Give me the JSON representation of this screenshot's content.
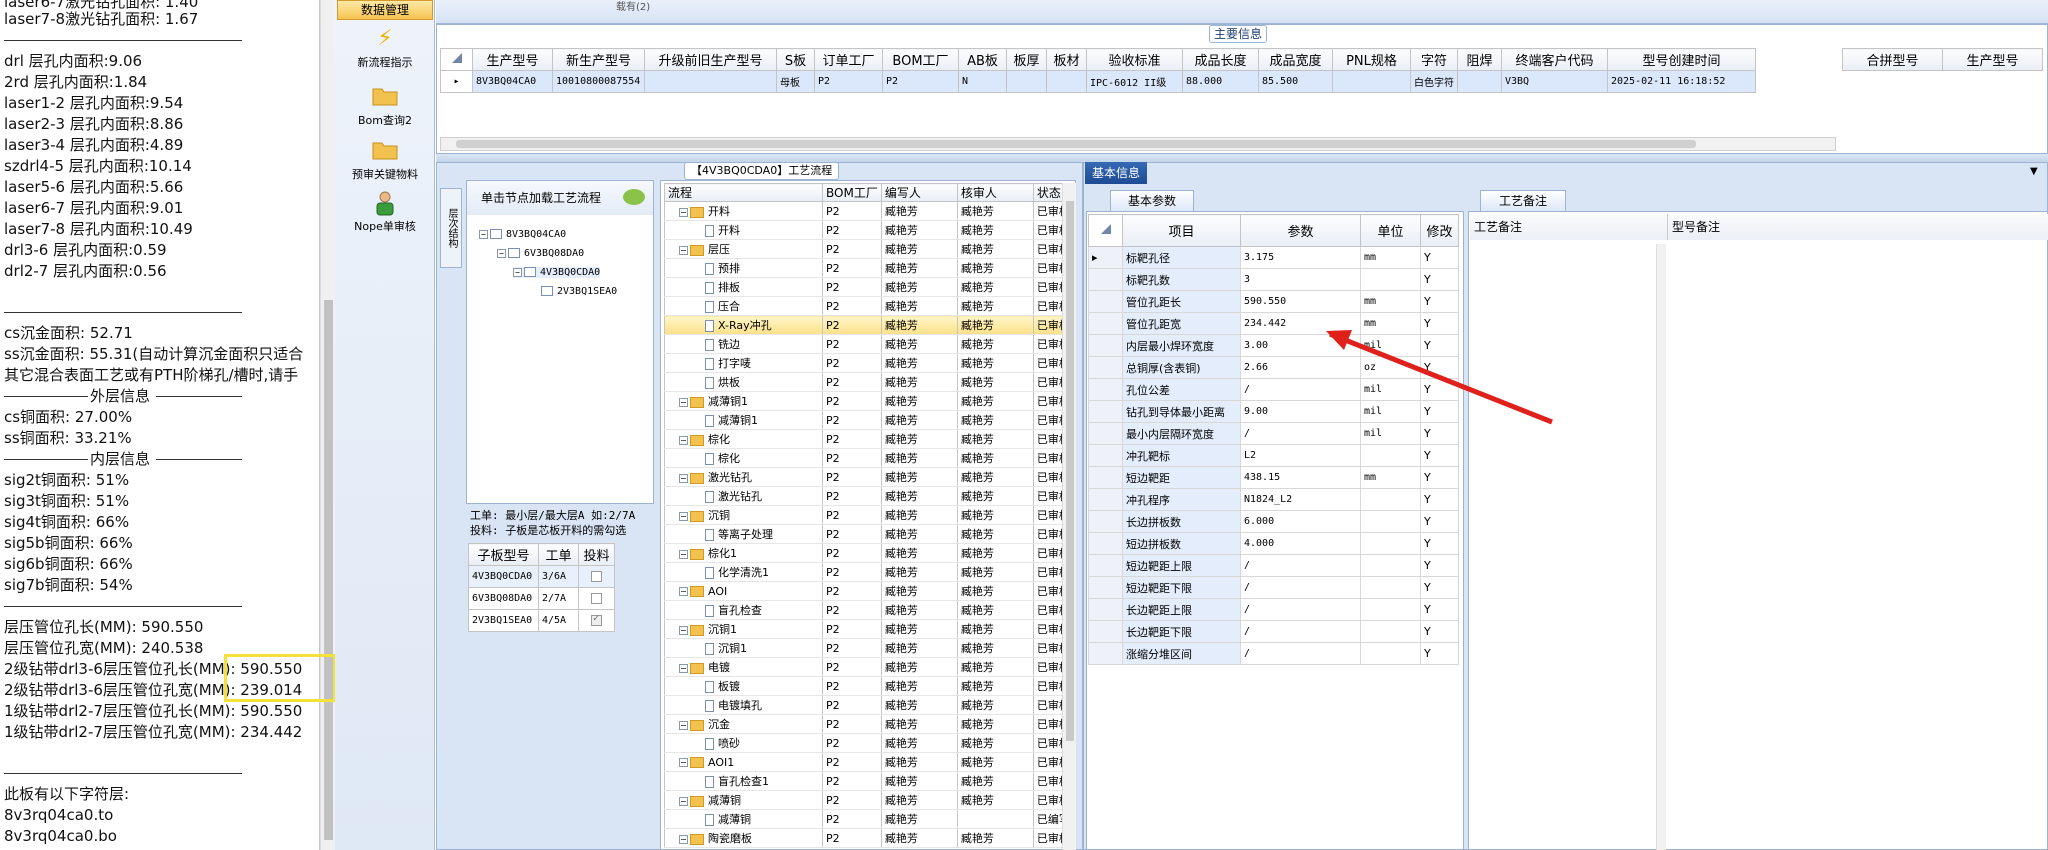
{
  "left_panel": {
    "lines": [
      "laser6-7激光钻孔面积: 1.40",
      "laser7-8激光钻孔面积: 1.67",
      "drl           层孔内面积:9.06",
      "2rd          层孔内面积:1.84",
      "laser1-2     层孔内面积:9.54",
      "laser2-3     层孔内面积:8.86",
      "laser3-4     层孔内面积:4.89",
      "szdrl4-5     层孔内面积:10.14",
      "laser5-6     层孔内面积:5.66",
      "laser6-7     层孔内面积:9.01",
      "laser7-8     层孔内面积:10.49",
      "drl3-6       层孔内面积:0.59",
      "drl2-7       层孔内面积:0.56",
      "cs沉金面积: 52.71",
      "ss沉金面积: 55.31(自动计算沉金面积只适合",
      "其它混合表面工艺或有PTH阶梯孔/槽时,请手",
      "外层信息",
      "cs铜面积: 27.00%",
      "ss铜面积: 33.21%",
      "内层信息",
      "sig2t铜面积: 51%",
      "sig3t铜面积: 51%",
      "sig4t铜面积: 66%",
      "sig5b铜面积: 66%",
      "sig6b铜面积: 66%",
      "sig7b铜面积: 54%",
      "层压管位孔长(MM): 590.550",
      "层压管位孔宽(MM): 240.538",
      "2级钻带drl3-6层压管位孔长(MM): 590.550",
      "2级钻带drl3-6层压管位孔宽(MM): 239.014",
      "1级钻带drl2-7层压管位孔长(MM): 590.550",
      "1级钻带drl2-7层压管位孔宽(MM): 234.442",
      "此板有以下字符层:",
      "8v3rq04ca0.to",
      "8v3rq04ca0.bo"
    ]
  },
  "toolbar": {
    "header": "数据管理",
    "buttons": [
      {
        "label": "新流程指示",
        "icon": "lightning-icon"
      },
      {
        "label": "Bom查询2",
        "icon": "folder-icon"
      },
      {
        "label": "预审关键物料",
        "icon": "folder-icon"
      },
      {
        "label": "Nope单审核",
        "icon": "person-icon"
      }
    ]
  },
  "top_bar": {
    "fragment": "载有(2)"
  },
  "main_info": {
    "legend": "主要信息",
    "columns": [
      "生产型号",
      "新生产型号",
      "升级前旧生产型号",
      "S板",
      "订单工厂",
      "BOM工厂",
      "AB板",
      "板厚",
      "板材",
      "验收标准",
      "成品长度",
      "成品宽度",
      "PNL规格",
      "字符",
      "阻焊",
      "终端客户代码",
      "型号创建时间"
    ],
    "row": [
      "8V3BQ04CA0",
      "10010800087554",
      "",
      "母板",
      "P2",
      "P2",
      "N",
      "",
      "",
      "IPC-6012 II级",
      "88.000",
      "85.500",
      "",
      "白色字符",
      "",
      "V3BQ",
      "2025-02-11 16:18:52"
    ],
    "combine_columns": [
      "合拼型号",
      "生产型号"
    ]
  },
  "flow": {
    "title": "【4V3BQ0CDA0】工艺流程",
    "side_tab": "层次结构",
    "tree_header": "单击节点加载工艺流程",
    "tree_nodes": [
      "8V3BQ04CA0",
      "6V3BQ08DA0",
      "4V3BQ0CDA0",
      "2V3BQ1SEA0"
    ],
    "note_line1": "工单: 最小层/最大层A 如:2/7A",
    "note_line2": "投料: 子板是芯板开料的需勾选",
    "sub_columns": [
      "子板型号",
      "工单",
      "投料"
    ],
    "sub_rows": [
      {
        "model": "4V3BQ0CDA0",
        "order": "3/6A",
        "checked": false
      },
      {
        "model": "6V3BQ08DA0",
        "order": "2/7A",
        "checked": false
      },
      {
        "model": "2V3BQ1SEA0",
        "order": "4/5A",
        "checked": true
      }
    ],
    "process_columns": [
      "流程",
      "BOM工厂",
      "编写人",
      "核审人",
      "状态"
    ],
    "process_rows": [
      {
        "name": "开料",
        "type": "folder",
        "factory": "P2",
        "writer": "臧艳芳",
        "reviewer": "臧艳芳",
        "status": "已审核"
      },
      {
        "name": "开料",
        "type": "doc",
        "factory": "P2",
        "writer": "臧艳芳",
        "reviewer": "臧艳芳",
        "status": "已审核"
      },
      {
        "name": "层压",
        "type": "folder",
        "factory": "P2",
        "writer": "臧艳芳",
        "reviewer": "臧艳芳",
        "status": "已审核"
      },
      {
        "name": "预排",
        "type": "doc",
        "factory": "P2",
        "writer": "臧艳芳",
        "reviewer": "臧艳芳",
        "status": "已审核"
      },
      {
        "name": "排板",
        "type": "doc",
        "factory": "P2",
        "writer": "臧艳芳",
        "reviewer": "臧艳芳",
        "status": "已审核"
      },
      {
        "name": "压合",
        "type": "doc",
        "factory": "P2",
        "writer": "臧艳芳",
        "reviewer": "臧艳芳",
        "status": "已审核"
      },
      {
        "name": "X-Ray冲孔",
        "type": "doc",
        "factory": "P2",
        "writer": "臧艳芳",
        "reviewer": "臧艳芳",
        "status": "已审核",
        "selected": true
      },
      {
        "name": "铣边",
        "type": "doc",
        "factory": "P2",
        "writer": "臧艳芳",
        "reviewer": "臧艳芳",
        "status": "已审核"
      },
      {
        "name": "打字唛",
        "type": "doc",
        "factory": "P2",
        "writer": "臧艳芳",
        "reviewer": "臧艳芳",
        "status": "已审核"
      },
      {
        "name": "烘板",
        "type": "doc",
        "factory": "P2",
        "writer": "臧艳芳",
        "reviewer": "臧艳芳",
        "status": "已审核"
      },
      {
        "name": "减薄铜1",
        "type": "folder",
        "factory": "P2",
        "writer": "臧艳芳",
        "reviewer": "臧艳芳",
        "status": "已审核"
      },
      {
        "name": "减薄铜1",
        "type": "doc",
        "factory": "P2",
        "writer": "臧艳芳",
        "reviewer": "臧艳芳",
        "status": "已审核"
      },
      {
        "name": "棕化",
        "type": "folder",
        "factory": "P2",
        "writer": "臧艳芳",
        "reviewer": "臧艳芳",
        "status": "已审核"
      },
      {
        "name": "棕化",
        "type": "doc",
        "factory": "P2",
        "writer": "臧艳芳",
        "reviewer": "臧艳芳",
        "status": "已审核"
      },
      {
        "name": "激光钻孔",
        "type": "folder",
        "factory": "P2",
        "writer": "臧艳芳",
        "reviewer": "臧艳芳",
        "status": "已审核"
      },
      {
        "name": "激光钻孔",
        "type": "doc",
        "factory": "P2",
        "writer": "臧艳芳",
        "reviewer": "臧艳芳",
        "status": "已审核"
      },
      {
        "name": "沉铜",
        "type": "folder",
        "factory": "P2",
        "writer": "臧艳芳",
        "reviewer": "臧艳芳",
        "status": "已审核"
      },
      {
        "name": "等离子处理",
        "type": "doc",
        "factory": "P2",
        "writer": "臧艳芳",
        "reviewer": "臧艳芳",
        "status": "已审核"
      },
      {
        "name": "棕化1",
        "type": "folder",
        "factory": "P2",
        "writer": "臧艳芳",
        "reviewer": "臧艳芳",
        "status": "已审核"
      },
      {
        "name": "化学清洗1",
        "type": "doc",
        "factory": "P2",
        "writer": "臧艳芳",
        "reviewer": "臧艳芳",
        "status": "已审核"
      },
      {
        "name": "AOI",
        "type": "folder",
        "factory": "P2",
        "writer": "臧艳芳",
        "reviewer": "臧艳芳",
        "status": "已审核"
      },
      {
        "name": "盲孔检查",
        "type": "doc",
        "factory": "P2",
        "writer": "臧艳芳",
        "reviewer": "臧艳芳",
        "status": "已审核"
      },
      {
        "name": "沉铜1",
        "type": "folder",
        "factory": "P2",
        "writer": "臧艳芳",
        "reviewer": "臧艳芳",
        "status": "已审核"
      },
      {
        "name": "沉铜1",
        "type": "doc",
        "factory": "P2",
        "writer": "臧艳芳",
        "reviewer": "臧艳芳",
        "status": "已审核"
      },
      {
        "name": "电镀",
        "type": "folder",
        "factory": "P2",
        "writer": "臧艳芳",
        "reviewer": "臧艳芳",
        "status": "已审核"
      },
      {
        "name": "板镀",
        "type": "doc",
        "factory": "P2",
        "writer": "臧艳芳",
        "reviewer": "臧艳芳",
        "status": "已审核"
      },
      {
        "name": "电镀填孔",
        "type": "doc",
        "factory": "P2",
        "writer": "臧艳芳",
        "reviewer": "臧艳芳",
        "status": "已审核"
      },
      {
        "name": "沉金",
        "type": "folder",
        "factory": "P2",
        "writer": "臧艳芳",
        "reviewer": "臧艳芳",
        "status": "已审核"
      },
      {
        "name": "喷砂",
        "type": "doc",
        "factory": "P2",
        "writer": "臧艳芳",
        "reviewer": "臧艳芳",
        "status": "已审核"
      },
      {
        "name": "AOI1",
        "type": "folder",
        "factory": "P2",
        "writer": "臧艳芳",
        "reviewer": "臧艳芳",
        "status": "已审核"
      },
      {
        "name": "盲孔检查1",
        "type": "doc",
        "factory": "P2",
        "writer": "臧艳芳",
        "reviewer": "臧艳芳",
        "status": "已审核"
      },
      {
        "name": "减薄铜",
        "type": "folder",
        "factory": "P2",
        "writer": "臧艳芳",
        "reviewer": "臧艳芳",
        "status": "已审核"
      },
      {
        "name": "减薄铜",
        "type": "doc",
        "factory": "P2",
        "writer": "臧艳芳",
        "reviewer": "",
        "status": "已编写"
      },
      {
        "name": "陶瓷磨板",
        "type": "folder",
        "factory": "P2",
        "writer": "臧艳芳",
        "reviewer": "臧艳芳",
        "status": "已审核"
      }
    ]
  },
  "basic_info": {
    "header": "基本信息",
    "tab": "基本参数",
    "columns": [
      "项目",
      "参数",
      "单位",
      "修改"
    ],
    "rows": [
      {
        "item": "标靶孔径",
        "value": "3.175",
        "unit": "mm",
        "mod": "Y"
      },
      {
        "item": "标靶孔数",
        "value": "3",
        "unit": "",
        "mod": "Y"
      },
      {
        "item": "管位孔距长",
        "value": "590.550",
        "unit": "mm",
        "mod": "Y"
      },
      {
        "item": "管位孔距宽",
        "value": "234.442",
        "unit": "mm",
        "mod": "Y"
      },
      {
        "item": "内层最小焊环宽度",
        "value": "3.00",
        "unit": "mil",
        "mod": "Y"
      },
      {
        "item": "总铜厚(含表铜)",
        "value": "2.66",
        "unit": "oz",
        "mod": "Y"
      },
      {
        "item": "孔位公差",
        "value": "/",
        "unit": "mil",
        "mod": "Y"
      },
      {
        "item": "钻孔到导体最小距离",
        "value": "9.00",
        "unit": "mil",
        "mod": "Y"
      },
      {
        "item": "最小内层隔环宽度",
        "value": "/",
        "unit": "mil",
        "mod": "Y"
      },
      {
        "item": "冲孔靶标",
        "value": "L2",
        "unit": "",
        "mod": "Y"
      },
      {
        "item": "短边靶距",
        "value": "438.15",
        "unit": "mm",
        "mod": "Y"
      },
      {
        "item": "冲孔程序",
        "value": "N1824_L2",
        "unit": "",
        "mod": "Y"
      },
      {
        "item": "长边拼板数",
        "value": "6.000",
        "unit": "",
        "mod": "Y"
      },
      {
        "item": "短边拼板数",
        "value": "4.000",
        "unit": "",
        "mod": "Y"
      },
      {
        "item": "短边靶距上限",
        "value": "/",
        "unit": "",
        "mod": "Y"
      },
      {
        "item": "短边靶距下限",
        "value": "/",
        "unit": "",
        "mod": "Y"
      },
      {
        "item": "长边靶距上限",
        "value": "/",
        "unit": "",
        "mod": "Y"
      },
      {
        "item": "长边靶距下限",
        "value": "/",
        "unit": "",
        "mod": "Y"
      },
      {
        "item": "涨缩分堆区间",
        "value": "/",
        "unit": "",
        "mod": "Y"
      }
    ]
  },
  "process_note": {
    "tab": "工艺备注",
    "col1": "工艺备注",
    "col2": "型号备注"
  },
  "colors": {
    "accent": "#1d4b94",
    "highlight_box": "#f4e23a",
    "annotation_arrow": "#e0201b",
    "selected_row": "#fbe089"
  }
}
